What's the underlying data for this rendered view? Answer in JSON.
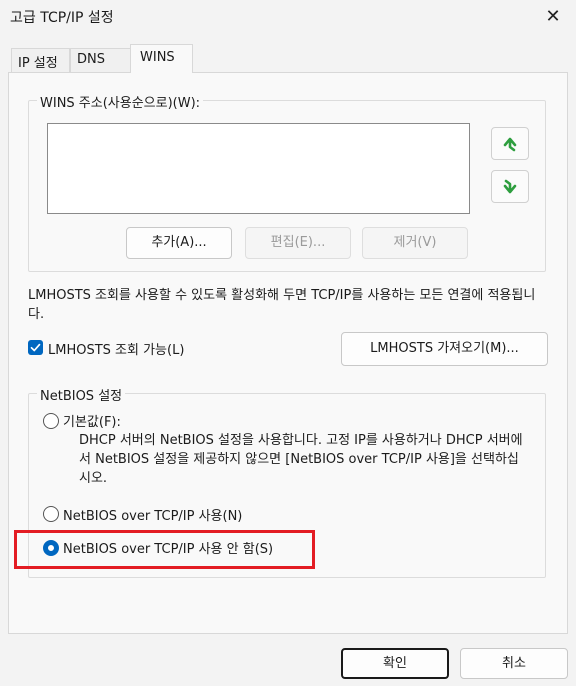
{
  "window": {
    "title": "고급 TCP/IP 설정",
    "close_icon": "close-icon"
  },
  "tabs": [
    {
      "label": "IP 설정"
    },
    {
      "label": "DNS"
    },
    {
      "label": "WINS",
      "active": true
    }
  ],
  "wins": {
    "group_label": "WINS 주소(사용순으로)(W):",
    "address_list": [],
    "up_icon": "arrow-up-icon",
    "down_icon": "arrow-down-icon",
    "add_label": "추가(A)...",
    "edit_label": "편집(E)...",
    "remove_label": "제거(V)"
  },
  "lmhosts": {
    "description": "LMHOSTS 조회를 사용할 수 있도록 활성화해 두면 TCP/IP를 사용하는 모든 연결에 적용됩니다.",
    "enable_label": "LMHOSTS 조회 가능(L)",
    "enable_checked": true,
    "import_label": "LMHOSTS 가져오기(M)..."
  },
  "netbios": {
    "group_label": "NetBIOS 설정",
    "options": [
      {
        "label": "기본값(F):",
        "checked": false
      },
      {
        "label": "NetBIOS over TCP/IP 사용(N)",
        "checked": false
      },
      {
        "label": "NetBIOS over TCP/IP 사용 안 함(S)",
        "checked": true
      }
    ],
    "default_description": "DHCP 서버의 NetBIOS 설정을 사용합니다. 고정 IP를 사용하거나 DHCP 서버에서 NetBIOS 설정을 제공하지 않으면 [NetBIOS over TCP/IP 사용]을 선택하십시오."
  },
  "footer": {
    "ok_label": "확인",
    "cancel_label": "취소"
  },
  "colors": {
    "accent": "#0067c0",
    "highlight_border": "#e31c23",
    "arrow_green": "#2e9e3f"
  }
}
